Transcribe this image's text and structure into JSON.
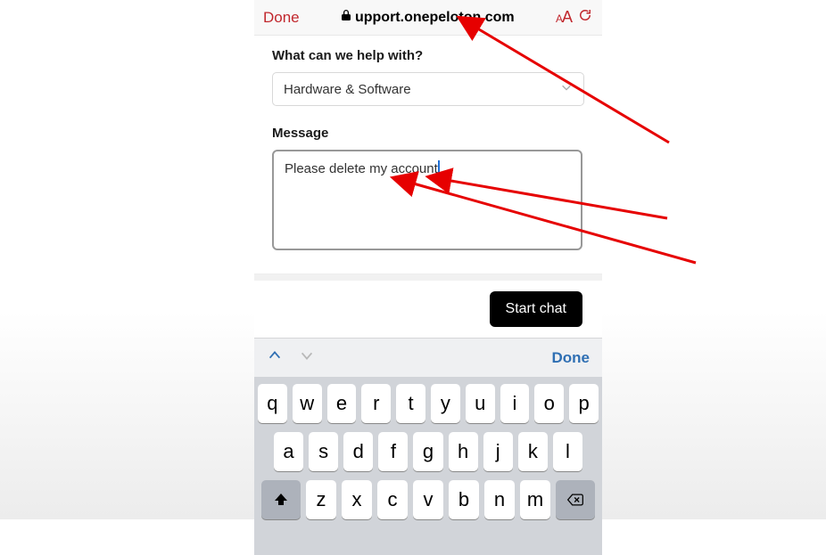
{
  "safari": {
    "done": "Done",
    "url": "upport.onepeloton.com"
  },
  "form": {
    "help_label": "What can we help with?",
    "topic_selected": "Hardware & Software",
    "message_label": "Message",
    "message_value": "Please delete my account",
    "start_chat": "Start chat"
  },
  "kb": {
    "done": "Done",
    "rows": [
      [
        "q",
        "w",
        "e",
        "r",
        "t",
        "y",
        "u",
        "i",
        "o",
        "p"
      ],
      [
        "a",
        "s",
        "d",
        "f",
        "g",
        "h",
        "j",
        "k",
        "l"
      ],
      [
        "z",
        "x",
        "c",
        "v",
        "b",
        "n",
        "m"
      ]
    ]
  }
}
